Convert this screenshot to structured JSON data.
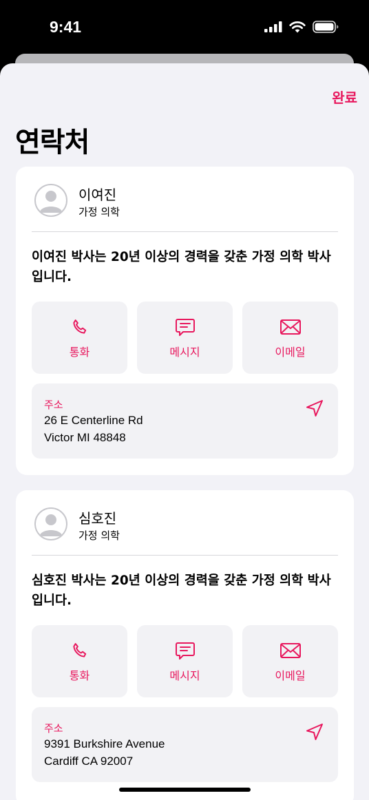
{
  "status": {
    "time": "9:41"
  },
  "header": {
    "done_label": "완료",
    "title": "연락처"
  },
  "contacts": [
    {
      "name": "이여진",
      "role": "가정 의학",
      "bio": "이여진 박사는 20년 이상의 경력을 갖춘 가정 의학 박사입니다.",
      "actions": {
        "call": "통화",
        "message": "메시지",
        "email": "이메일"
      },
      "address": {
        "label": "주소",
        "line1": "26 E Centerline Rd",
        "line2": "Victor MI 48848"
      }
    },
    {
      "name": "심호진",
      "role": "가정 의학",
      "bio": "심호진 박사는 20년 이상의 경력을 갖춘 가정 의학 박사입니다.",
      "actions": {
        "call": "통화",
        "message": "메시지",
        "email": "이메일"
      },
      "address": {
        "label": "주소",
        "line1": "9391 Burkshire Avenue",
        "line2": "Cardiff CA 92007"
      }
    }
  ],
  "colors": {
    "accent": "#e8175d",
    "background": "#f2f2f7",
    "card": "#ffffff",
    "tile": "#f2f2f5"
  },
  "icons": [
    "signal-icon",
    "wifi-icon",
    "battery-icon",
    "avatar-icon",
    "phone-icon",
    "message-icon",
    "mail-icon",
    "location-arrow-icon"
  ]
}
